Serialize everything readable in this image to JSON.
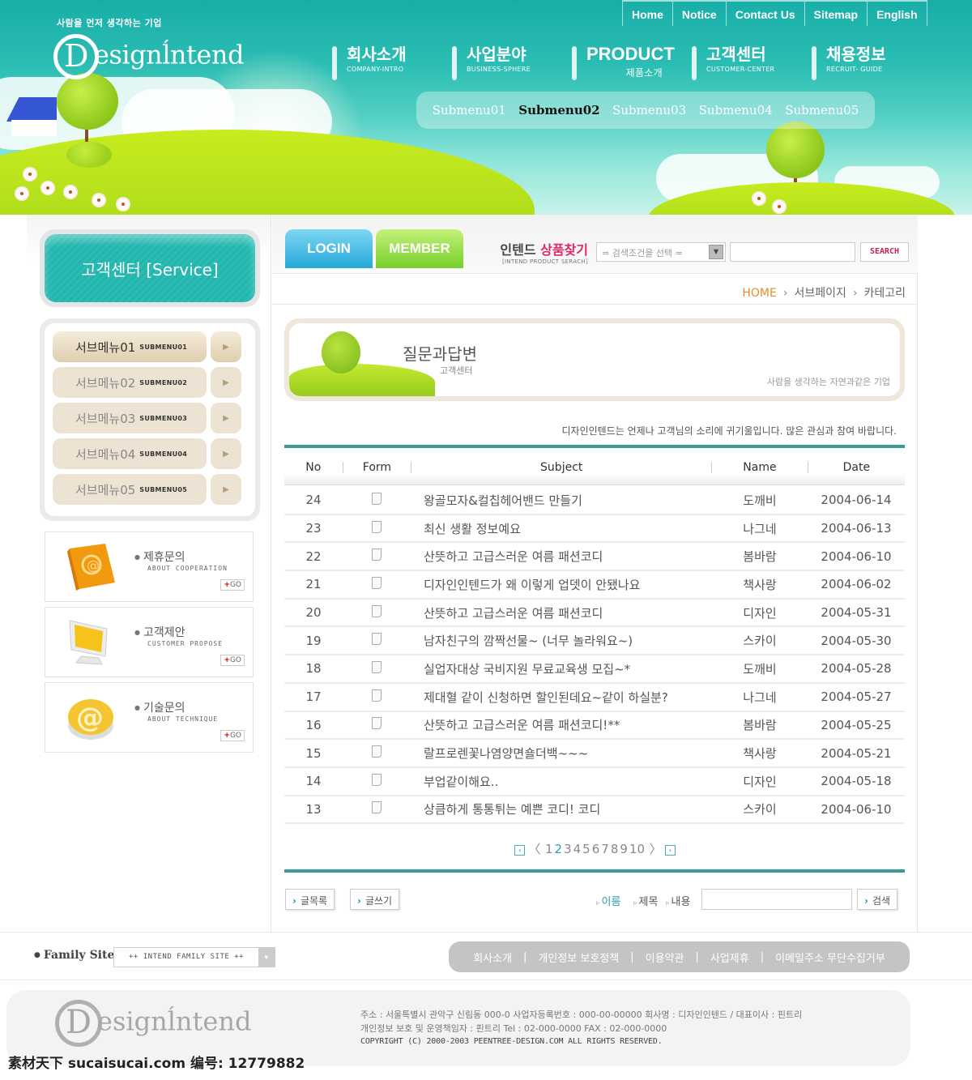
{
  "header": {
    "slogan": "사람을 먼저 생각하는 기업",
    "logo": {
      "initial": "D",
      "text": "esign",
      "accent": "ĺ",
      "text2": "ntend"
    },
    "top_nav": [
      "Home",
      "Notice",
      "Contact Us",
      "Sitemap",
      "English"
    ],
    "main_nav": [
      {
        "ko": "회사소개",
        "en": "COMPANY-INTRO",
        "active": false
      },
      {
        "ko": "사업분야",
        "en": "BUSINESS-SPHERE",
        "active": false
      },
      {
        "ko": "PRODUCT",
        "en": "제품소개",
        "active": true
      },
      {
        "ko": "고객센터",
        "en": "CUSTOMER-CENTER",
        "active": false
      },
      {
        "ko": "채용정보",
        "en": "RECRUIT- GUIDE",
        "active": false
      }
    ],
    "sub_nav": [
      "Submenu01",
      "Submenu02",
      "Submenu03",
      "Submenu04",
      "Submenu05"
    ],
    "sub_nav_active_index": 1
  },
  "sidebar": {
    "title": "고객센터 [Service]",
    "submenu": [
      {
        "ko": "서브메뉴01",
        "en": "SUBMENU01"
      },
      {
        "ko": "서브메뉴02",
        "en": "SUBMENU02"
      },
      {
        "ko": "서브메뉴03",
        "en": "SUBMENU03"
      },
      {
        "ko": "서브메뉴04",
        "en": "SUBMENU04"
      },
      {
        "ko": "서브메뉴05",
        "en": "SUBMENU05"
      }
    ],
    "contacts": [
      {
        "title": "제휴문의",
        "subtitle": "ABOUT  COOPERATION",
        "go": "GO",
        "icon": "email-book-icon"
      },
      {
        "title": "고객제안",
        "subtitle": "CUSTOMER  PROPOSE",
        "go": "GO",
        "icon": "monitor-icon"
      },
      {
        "title": "기술문의",
        "subtitle": "ABOUT TECHNIQUE",
        "go": "GO",
        "icon": "at-sign-icon"
      }
    ]
  },
  "topbar": {
    "login": "LOGIN",
    "member": "MEMBER",
    "product_search": {
      "prefix": "인텐드 ",
      "highlight": "상품찾기",
      "subtitle": "[INTEND PRODUCT SERACH]"
    },
    "select_placeholder": "= 검색조건을 선택 =",
    "search_button": "SEARCH"
  },
  "breadcrumb": [
    "HOME",
    "서브페이지",
    "카테고리"
  ],
  "banner": {
    "title": "질문과답변",
    "subtitle": "고객센터",
    "slogan": "사람을 생각하는 자연과같은 기업"
  },
  "notice": "디자인인텐드는 언제나 고객님의 소리에 귀기울입니다. 많은 관심과 참여 바랍니다.",
  "table": {
    "headers": [
      "No",
      "Form",
      "Subject",
      "Name",
      "Date"
    ],
    "rows": [
      {
        "no": "24",
        "subject": "왕골모자&컬칩헤어밴드 만들기",
        "name": "도깨비",
        "date": "2004-06-14"
      },
      {
        "no": "23",
        "subject": "최신 생활 정보예요",
        "name": "나그네",
        "date": "2004-06-13"
      },
      {
        "no": "22",
        "subject": "산뜻하고 고급스러운 여름 패션코디",
        "name": "봄바람",
        "date": "2004-06-10"
      },
      {
        "no": "21",
        "subject": "디자인인텐드가  왜 이렇게 업뎃이 안됐나요",
        "name": "책사랑",
        "date": "2004-06-02"
      },
      {
        "no": "20",
        "subject": "산뜻하고 고급스러운 여름 패션코디",
        "name": "디자인",
        "date": "2004-05-31"
      },
      {
        "no": "19",
        "subject": "남자친구의 깜짝선물~ (너무 놀라워요~)",
        "name": "스카이",
        "date": "2004-05-30"
      },
      {
        "no": "18",
        "subject": "실업자대상 국비지원 무료교육생 모집~*",
        "name": "도깨비",
        "date": "2004-05-28"
      },
      {
        "no": "17",
        "subject": "제대혈 같이 신청하면 할인된데요~같이 하실분?",
        "name": "나그네",
        "date": "2004-05-27"
      },
      {
        "no": "16",
        "subject": "산뜻하고 고급스러운 여름 패션코디!**",
        "name": "봄바람",
        "date": "2004-05-25"
      },
      {
        "no": "15",
        "subject": "랄프로렌꽃나염양면숄더백~~~",
        "name": "책사랑",
        "date": "2004-05-21"
      },
      {
        "no": "14",
        "subject": "부업같이해요..",
        "name": "디자인",
        "date": "2004-05-18"
      },
      {
        "no": "13",
        "subject": "상큼하게 통통튀는 예쁜 코디! 코디",
        "name": "스카이",
        "date": "2004-06-10"
      }
    ]
  },
  "pager": {
    "prev": "‹",
    "next": "›",
    "pages": [
      "1",
      "2",
      "3",
      "4",
      "5",
      "6",
      "7",
      "8",
      "9",
      "10"
    ],
    "current": "2"
  },
  "board_actions": {
    "list": "글목록",
    "write": "글쓰기",
    "search_types": [
      "이름",
      "제목",
      "내용"
    ],
    "search_type_selected": "이름",
    "search_button": "검색"
  },
  "footer": {
    "family_label": "Family Site :",
    "family_select": "++ INTEND FAMILY SITE ++",
    "links": [
      "회사소개",
      "개인정보 보호정책",
      "이용약관",
      "사업제휴",
      "이메일주소 무단수집거부"
    ],
    "address_line1": "주소 : 서울특별시 관악구 신림동 000-0  사업자등록번호 : 000-00-00000 회사명 : 디자인인텐드  / 대표이사 : 핀트리",
    "address_line2": "개인정보 보호 및 운영책임자 :  핀트리   Tel : 02-000-0000  FAX : 02-000-0000",
    "copyright": "COPYRIGHT (C) 2000-2003 PEENTREE-DESIGN.COM  ALL RIGHTS RESERVED."
  },
  "watermark": "素材天下 sucaisucai.com  编号: 12779882",
  "colors": {
    "accent_teal": "#3a9a98",
    "highlight_pink": "#e0276b",
    "breadcrumb_home": "#e58d26",
    "page_active": "#2e9bb5"
  }
}
